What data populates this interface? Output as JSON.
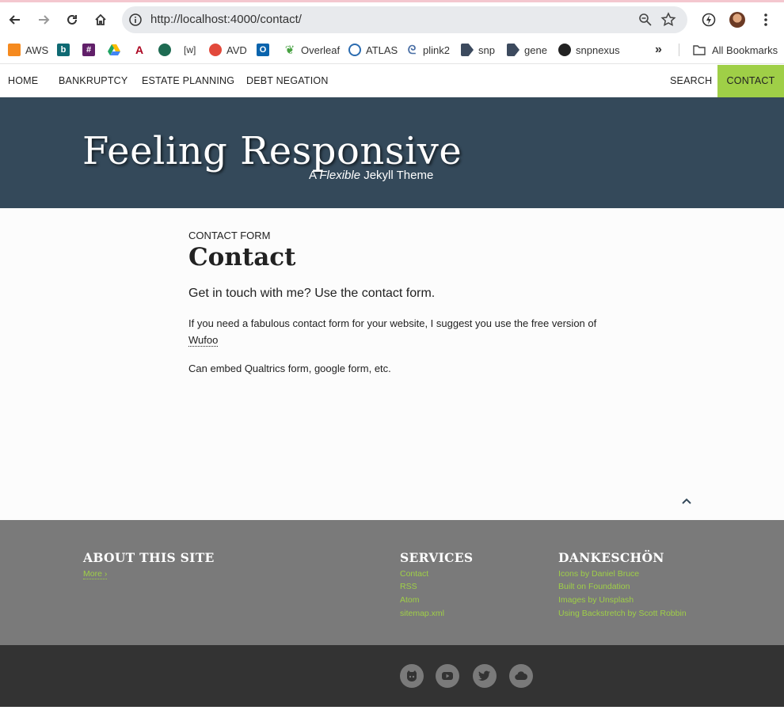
{
  "browser": {
    "url": "http://localhost:4000/contact/",
    "bookmarks": [
      {
        "label": "AWS",
        "icon": "aws-icon",
        "color": "#f58a1f"
      },
      {
        "label": "",
        "icon": "b-icon",
        "color": "#0f6a73",
        "glyph": "b"
      },
      {
        "label": "",
        "icon": "slack-icon",
        "color": "#611f69",
        "glyph": "#"
      },
      {
        "label": "",
        "icon": "drive-icon",
        "color": "#1fa463"
      },
      {
        "label": "",
        "icon": "arizona-icon",
        "color": "#ab0520",
        "glyph": "A"
      },
      {
        "label": "",
        "icon": "starbucks-icon",
        "color": "#1e6b52",
        "glyph": "◎"
      },
      {
        "label": "",
        "icon": "wiki-icon",
        "color": "#ffffff",
        "glyph": "[w]"
      },
      {
        "label": "AVD",
        "icon": "avd-icon",
        "color": "#e2493b"
      },
      {
        "label": "",
        "icon": "outlook-icon",
        "color": "#0a64ad",
        "glyph": "O"
      },
      {
        "label": "Overleaf",
        "icon": "overleaf-icon",
        "color": "#47a141"
      },
      {
        "label": "ATLAS",
        "icon": "atlas-icon",
        "color": "#2b6cb0"
      },
      {
        "label": "plink2",
        "icon": "plink-icon",
        "color": "#4a6fa5"
      },
      {
        "label": "snp",
        "icon": "snp-icon",
        "color": "#3c4a5e"
      },
      {
        "label": "gene",
        "icon": "gene-icon",
        "color": "#3c4a5e"
      },
      {
        "label": "snpnexus",
        "icon": "snpnexus-icon",
        "color": "#222222"
      }
    ],
    "all_bookmarks": "All Bookmarks"
  },
  "nav": {
    "items": [
      "HOME",
      "BANKRUPTCY",
      "ESTATE PLANNING",
      "DEBT NEGATION"
    ],
    "search": "SEARCH",
    "contact": "CONTACT",
    "accent": "#9fcf47"
  },
  "masthead": {
    "title": "Feeling Responsive",
    "tagline_a": "A ",
    "tagline_em": "Flexible",
    "tagline_b": " Jekyll Theme",
    "bg": "#34495a"
  },
  "page": {
    "kicker": "CONTACT FORM",
    "title": "Contact",
    "lead": "Get in touch with me? Use the contact form.",
    "p1_text": "If you need a fabulous contact form for your website, I suggest you use the free version of ",
    "p1_link": "Wufoo",
    "p2": "Can embed Qualtrics form, google form, etc."
  },
  "footer": {
    "about": {
      "title": "ABOUT THIS SITE",
      "more": "More ›"
    },
    "services": {
      "title": "SERVICES",
      "links": [
        "Contact",
        "RSS",
        "Atom",
        "sitemap.xml"
      ]
    },
    "dankeschon": {
      "title": "DANKESCHÖN",
      "links": [
        "Icons by Daniel Bruce",
        "Built on Foundation",
        "Images by Unsplash",
        "Using Backstretch by Scott Robbin"
      ]
    },
    "social": [
      "github-icon",
      "youtube-icon",
      "twitter-icon",
      "cloud-icon"
    ]
  }
}
